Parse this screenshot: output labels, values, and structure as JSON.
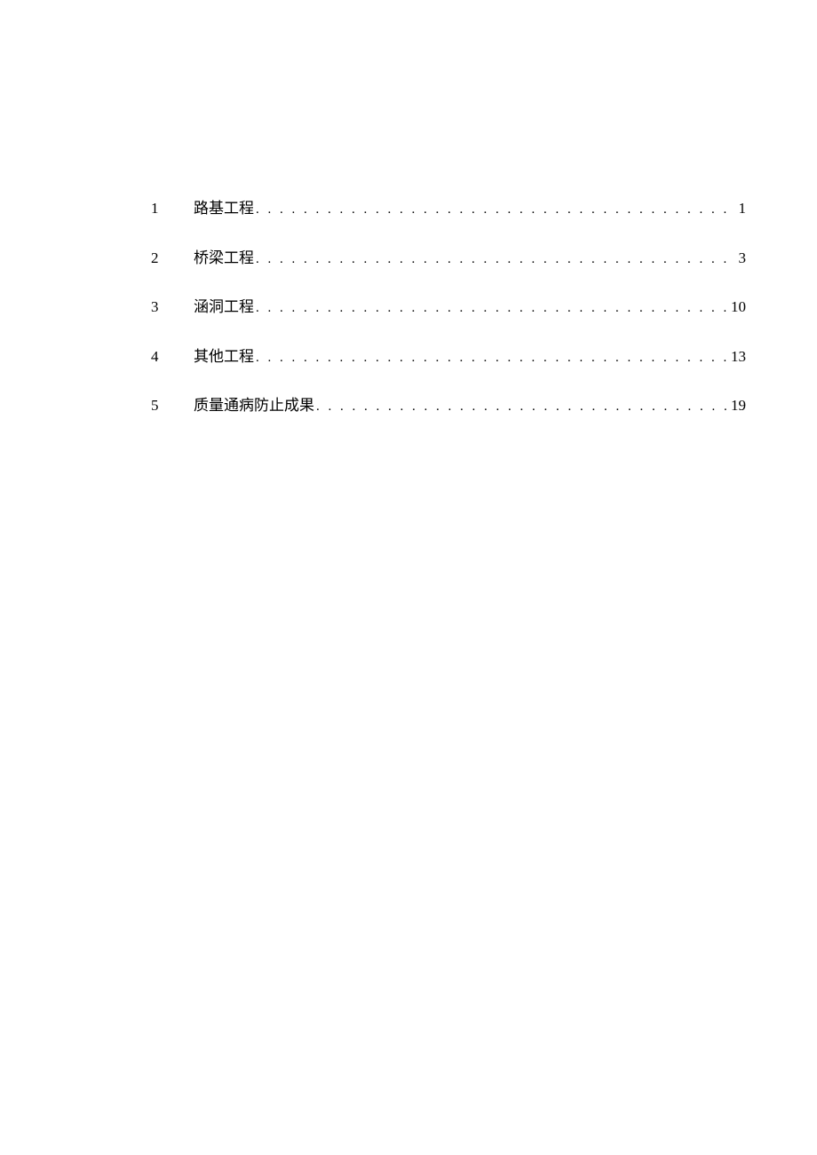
{
  "toc": {
    "entries": [
      {
        "number": "1",
        "title": "路基工程",
        "page": "1"
      },
      {
        "number": "2",
        "title": "桥梁工程",
        "page": "3"
      },
      {
        "number": "3",
        "title": "涵洞工程",
        "page": "10"
      },
      {
        "number": "4",
        "title": "其他工程",
        "page": "13"
      },
      {
        "number": "5",
        "title": "质量通病防止成果",
        "page": "19"
      }
    ]
  }
}
